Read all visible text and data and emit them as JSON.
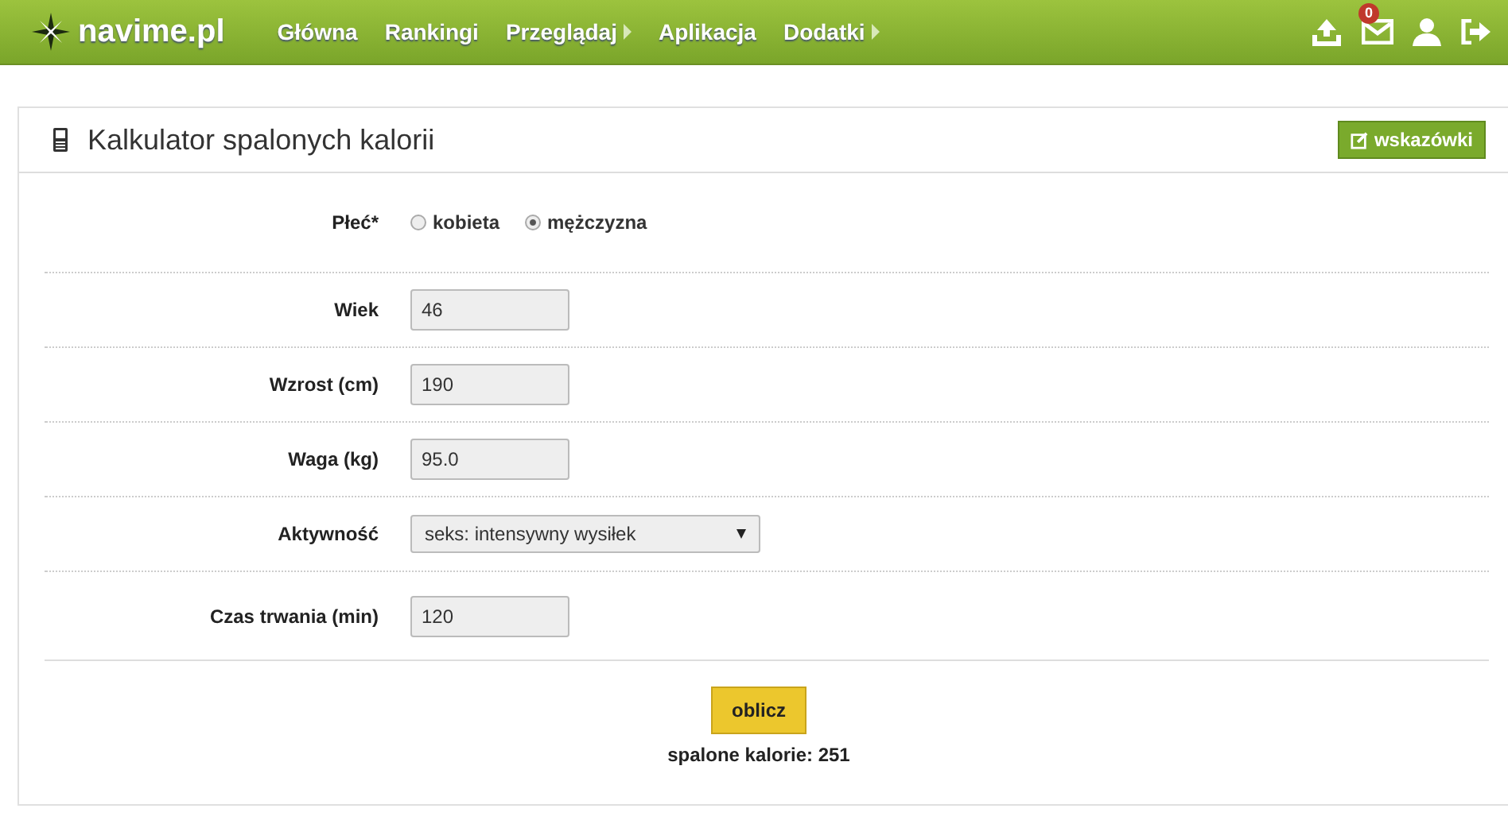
{
  "navbar": {
    "logo": "navime.pl",
    "items": [
      {
        "label": "Główna",
        "has_submenu": false
      },
      {
        "label": "Rankingi",
        "has_submenu": false
      },
      {
        "label": "Przeglądaj",
        "has_submenu": true
      },
      {
        "label": "Aplikacja",
        "has_submenu": false
      },
      {
        "label": "Dodatki",
        "has_submenu": true
      }
    ],
    "message_count": "0"
  },
  "panel": {
    "title": "Kalkulator spalonych kalorii",
    "hint_button": "wskazówki"
  },
  "form": [
    {
      "kind": "radio",
      "label": "Płeć*",
      "options": [
        {
          "label": "kobieta",
          "selected": false
        },
        {
          "label": "mężczyzna",
          "selected": true
        }
      ]
    },
    {
      "kind": "input",
      "label": "Wiek",
      "value": "46"
    },
    {
      "kind": "input",
      "label": "Wzrost (cm)",
      "value": "190"
    },
    {
      "kind": "input",
      "label": "Waga (kg)",
      "value": "95.0"
    },
    {
      "kind": "select",
      "label": "Aktywność",
      "value": "seks: intensywny wysiłek"
    },
    {
      "kind": "input",
      "label": "Czas trwania (min)",
      "value": "120"
    }
  ],
  "submit_button": "oblicz",
  "result": "spalone kalorie: 251"
}
